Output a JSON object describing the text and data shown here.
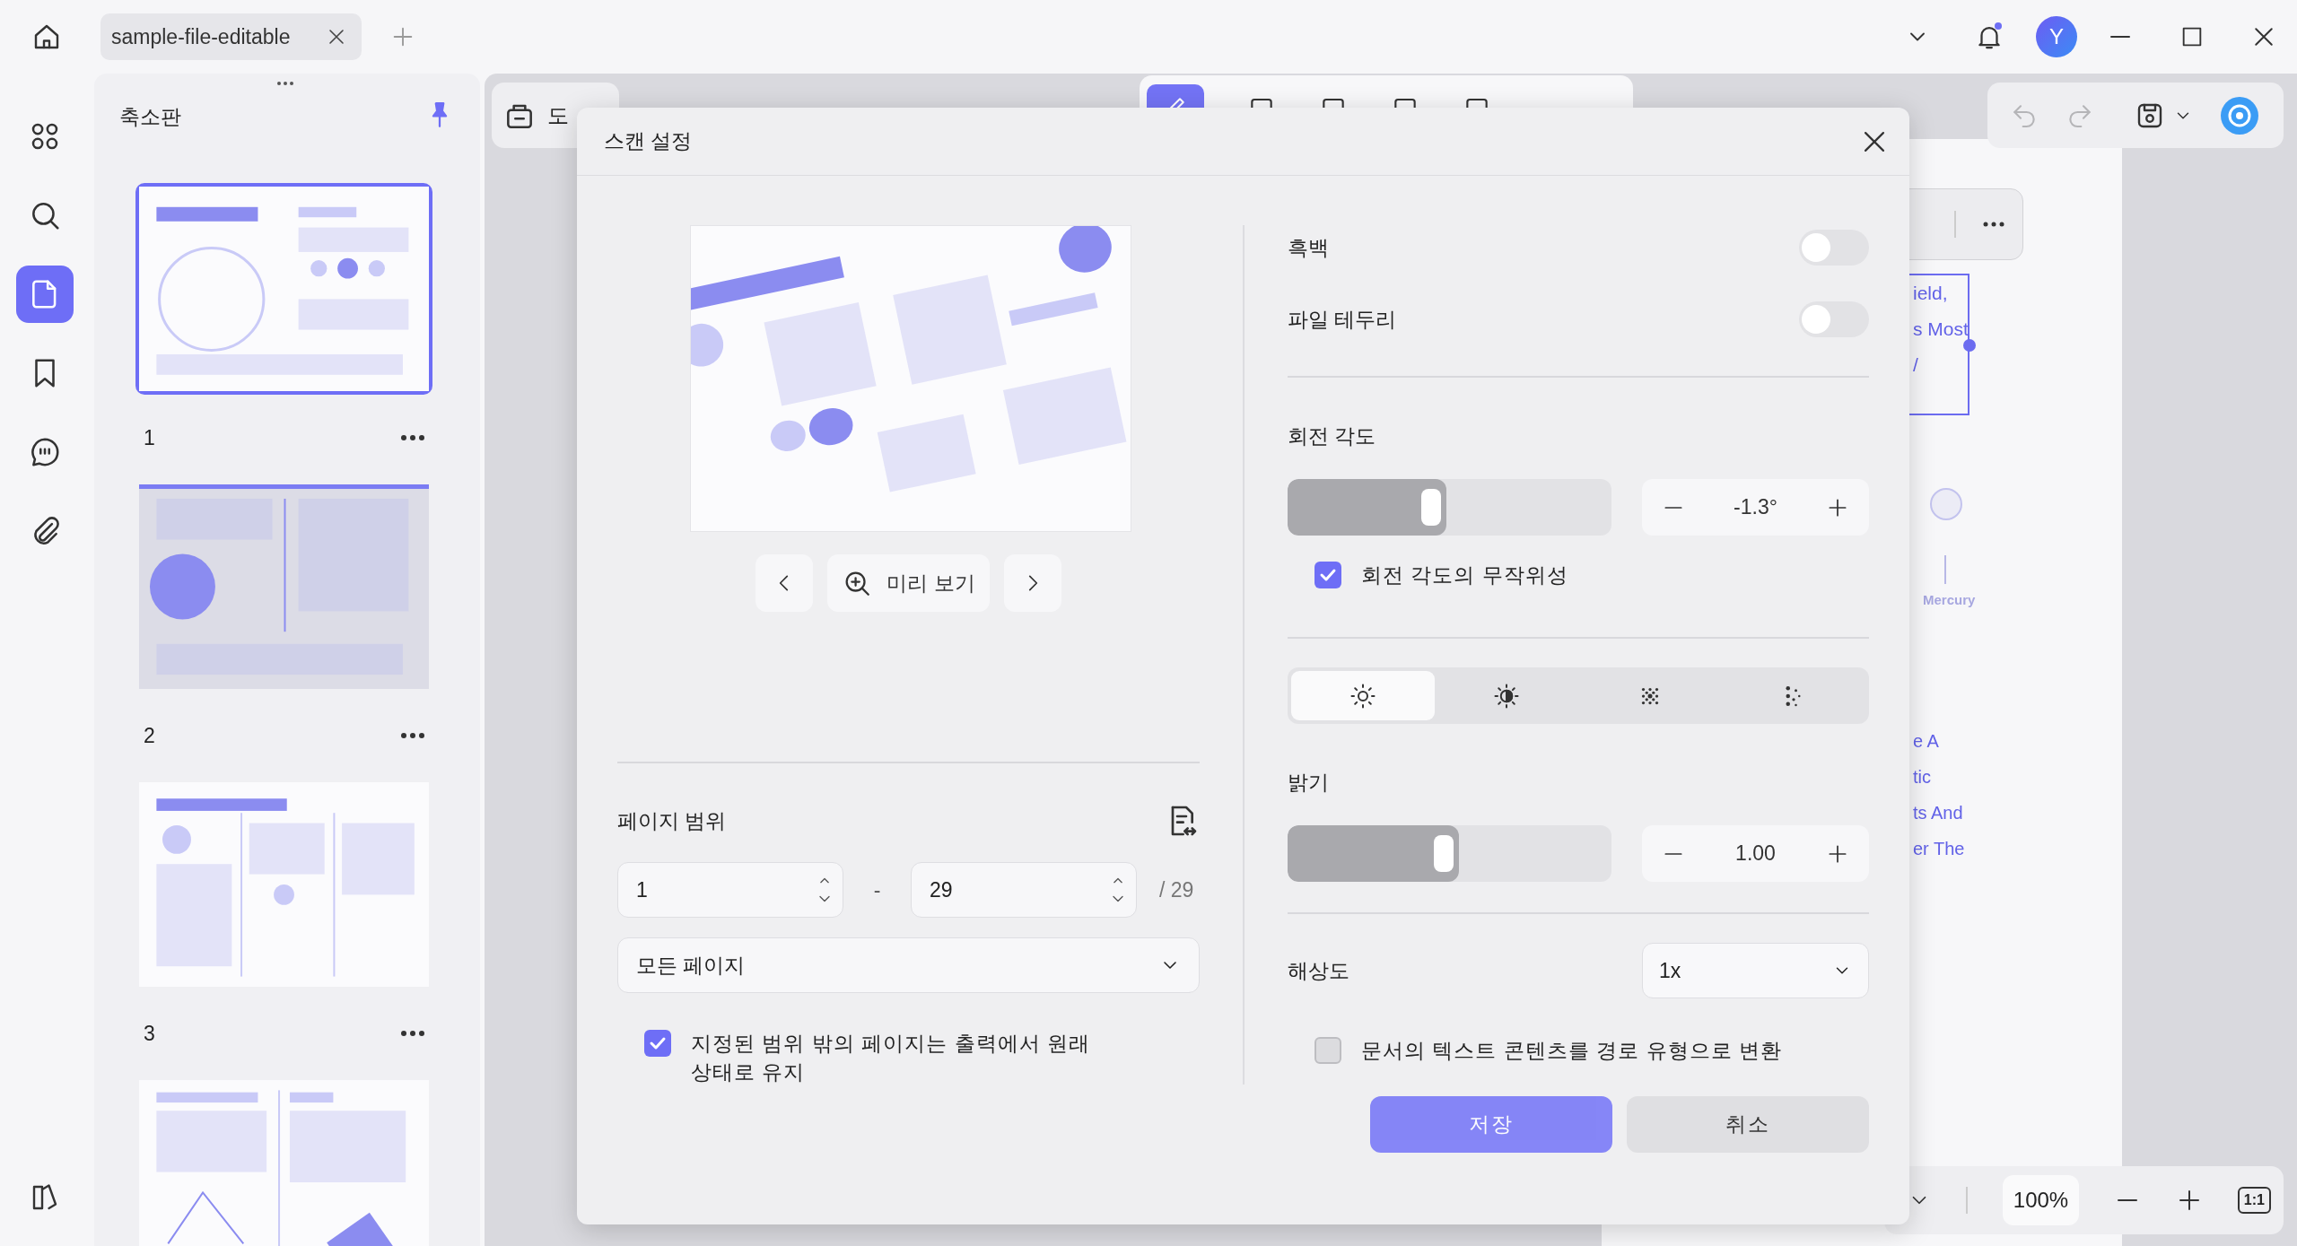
{
  "titlebar": {
    "tabs": [
      {
        "label": "sample-file-editable",
        "selected": true
      }
    ],
    "avatar": "Y",
    "notification": true
  },
  "rail": {
    "items": [
      {
        "kind": "grid",
        "selected": false
      },
      {
        "kind": "search",
        "selected": false
      },
      {
        "kind": "page",
        "selected": true
      },
      {
        "kind": "bookmark",
        "selected": false
      },
      {
        "kind": "comment",
        "selected": false
      },
      {
        "kind": "attachment",
        "selected": false
      }
    ]
  },
  "thumbnails": {
    "title": "축소판",
    "pages": [
      {
        "label": "1",
        "selected": true
      },
      {
        "label": "2",
        "selected": false
      },
      {
        "label": "3",
        "selected": false
      },
      {
        "selected": false
      }
    ]
  },
  "toolbar": {
    "button": "도"
  },
  "document": {
    "box_lines": [
      "ield,",
      "s Most",
      "/"
    ],
    "planet": "Mercury",
    "lines": [
      "e A",
      "tic",
      "ts And",
      "er The"
    ]
  },
  "zoom": {
    "value": "100%",
    "reset": "1:1"
  },
  "dialog": {
    "title": "스캔 설정",
    "preview": {
      "button": "미리 보기"
    },
    "page_range": {
      "label": "페이지 범위",
      "from": "1",
      "separator": "-",
      "to": "29",
      "total": "/ 29",
      "mode": "모든 페이지"
    },
    "keep_outside": {
      "label": "지정된 범위 밖의 페이지는 출력에서 원래 상태로 유지",
      "checked": true
    },
    "toggles": [
      {
        "label": "흑백",
        "on": false
      },
      {
        "label": "파일 테두리",
        "on": false
      }
    ],
    "rotation": {
      "label": "회전 각도",
      "level": 0.49,
      "value": "-1.3°"
    },
    "random_rotation": {
      "label": "회전 각도의 무작위성",
      "checked": true
    },
    "modes": [
      {
        "kind": "sun",
        "selected": true
      },
      {
        "kind": "contrast",
        "selected": false
      },
      {
        "kind": "dots-grid",
        "selected": false
      },
      {
        "kind": "dots-scatter",
        "selected": false
      }
    ],
    "brightness": {
      "label": "밝기",
      "level": 0.53,
      "value": "1.00"
    },
    "resolution": {
      "label": "해상도",
      "value": "1x"
    },
    "convert_text": {
      "label": "문서의 텍스트 콘텐츠를 경로 유형으로 변환",
      "checked": false
    },
    "buttons": [
      {
        "kind": "primary",
        "label": "저장"
      },
      {
        "kind": "secondary",
        "label": "취소"
      }
    ]
  }
}
